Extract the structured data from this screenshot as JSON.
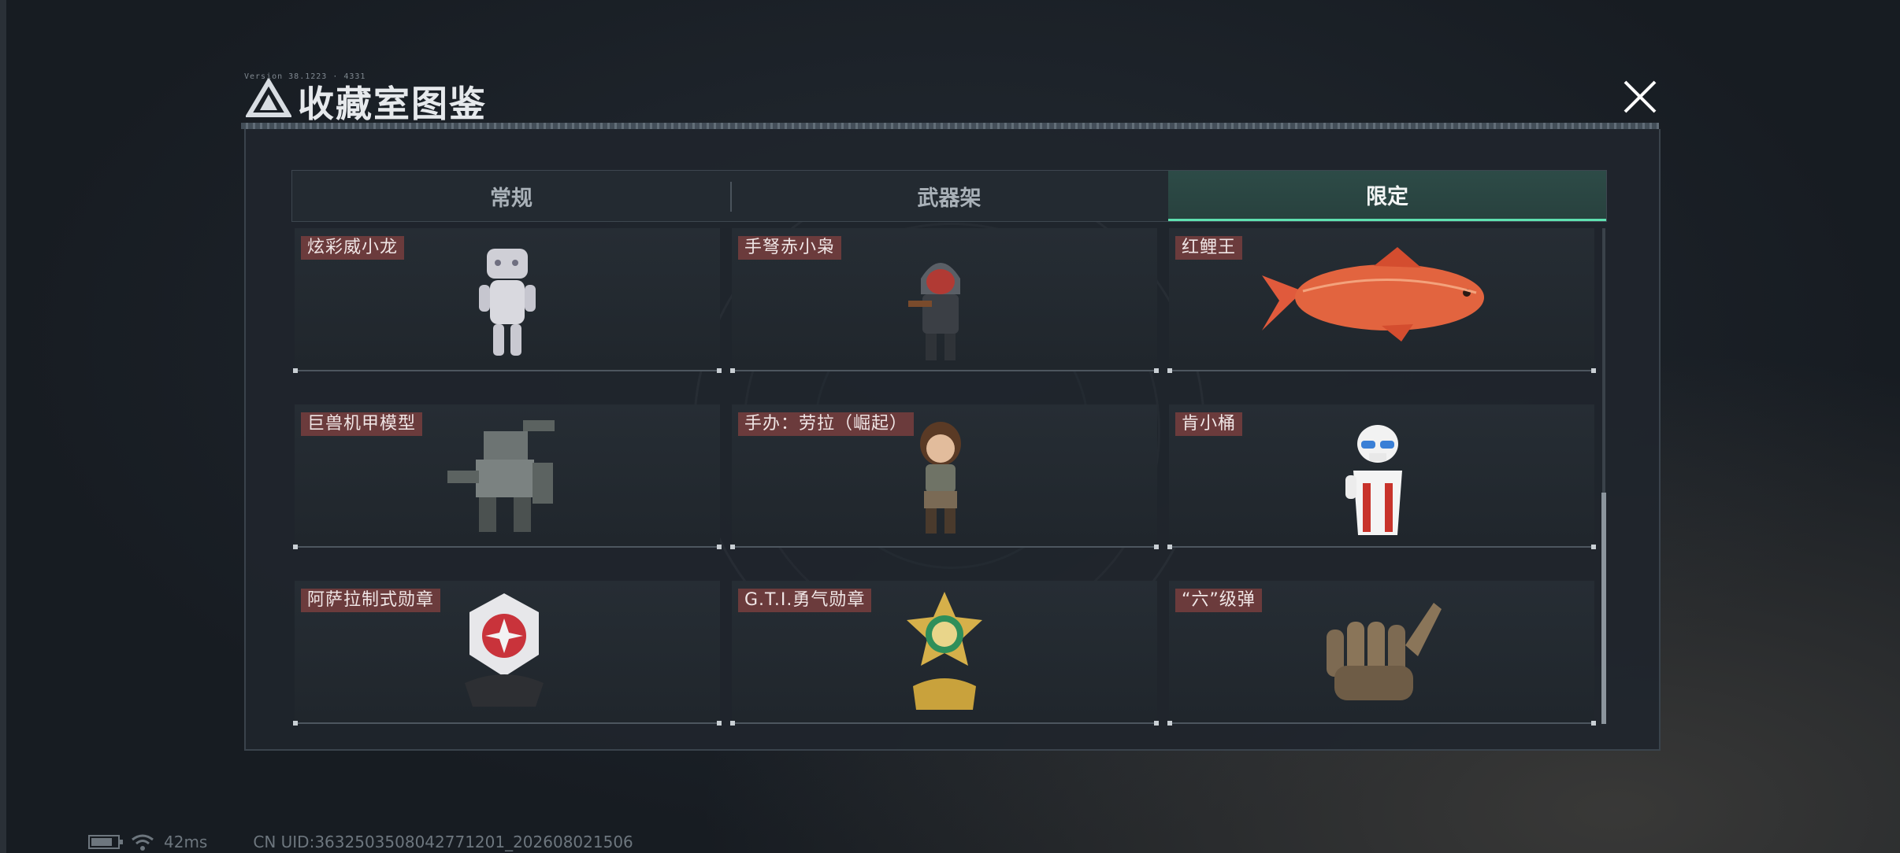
{
  "header": {
    "tiny_text": "Version 38.1223 · 4331",
    "title": "收藏室图鉴",
    "close_icon": "close-icon"
  },
  "tabs": [
    {
      "label": "常规",
      "active": false
    },
    {
      "label": "武器架",
      "active": false
    },
    {
      "label": "限定",
      "active": true
    }
  ],
  "items": [
    {
      "label": "炫彩威小龙",
      "icon": "white-toy-figure"
    },
    {
      "label": "手弩赤小枭",
      "icon": "hooded-crossbow-figure"
    },
    {
      "label": "红鲤王",
      "icon": "red-carp-fish"
    },
    {
      "label": "巨兽机甲模型",
      "icon": "mech-model"
    },
    {
      "label": "手办：劳拉（崛起）",
      "icon": "lara-figurine"
    },
    {
      "label": "肯小桶",
      "icon": "kfc-bucket-figure"
    },
    {
      "label": "阿萨拉制式勋章",
      "icon": "red-white-medal"
    },
    {
      "label": "G.T.I.勇气勋章",
      "icon": "gold-star-medal"
    },
    {
      "label": "“六”级弹",
      "icon": "bullet-hand-sign"
    }
  ],
  "footer": {
    "ping": "42ms",
    "uid": "CN UID:363250350804277120​1_202608021506"
  },
  "colors": {
    "active_tab_accent": "#5fe0b0",
    "label_bg": "#6b3b3c"
  }
}
